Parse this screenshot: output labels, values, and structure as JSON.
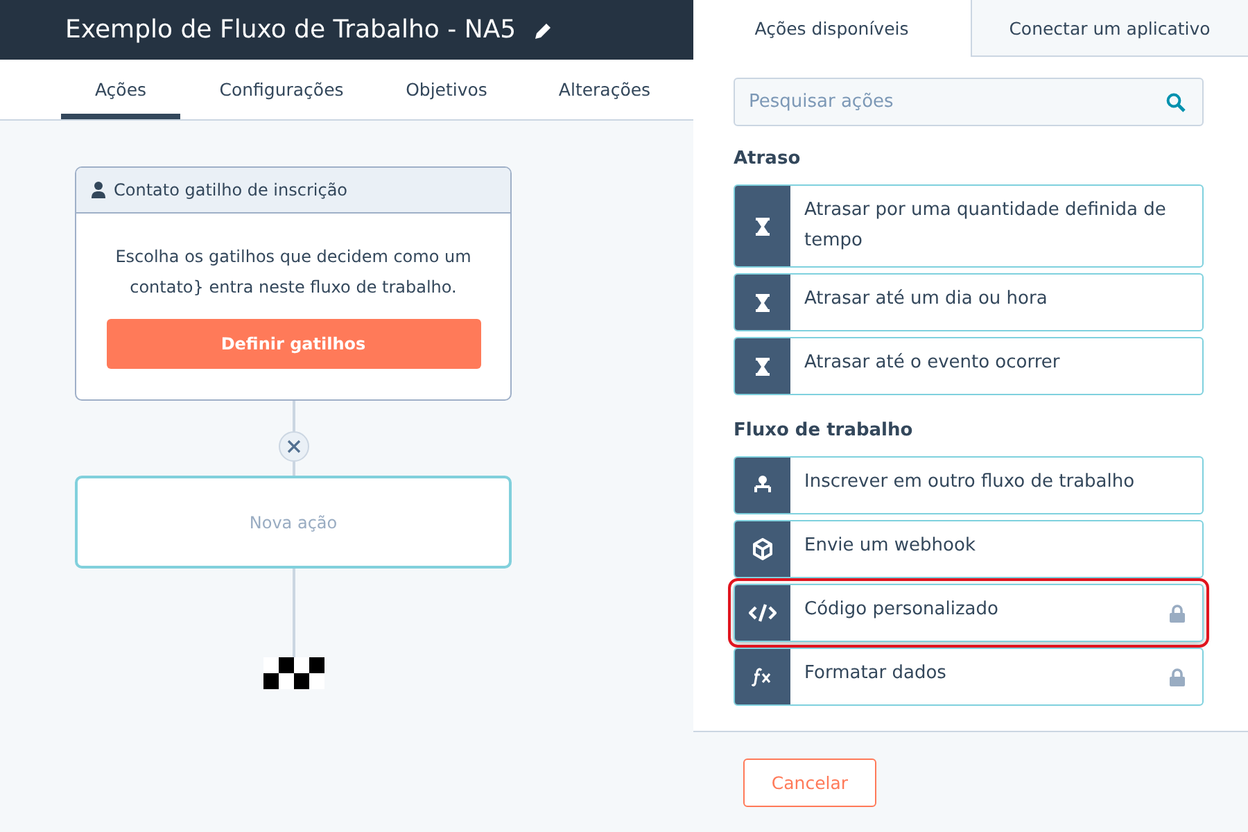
{
  "header": {
    "title": "Exemplo de Fluxo de Trabalho - NA5"
  },
  "tabs": [
    {
      "label": "Ações",
      "selected": true
    },
    {
      "label": "Configurações",
      "selected": false
    },
    {
      "label": "Objetivos",
      "selected": false
    },
    {
      "label": "Alterações",
      "selected": false
    }
  ],
  "canvas": {
    "trigger_card": {
      "title": "Contato gatilho de inscrição",
      "description": "Escolha os gatilhos que decidem como um contato} entra neste fluxo de trabalho.",
      "button": "Definir gatilhos"
    },
    "new_action": {
      "label": "Nova ação"
    }
  },
  "panel": {
    "tabs": [
      {
        "label": "Ações disponíveis",
        "selected": true
      },
      {
        "label": "Conectar um aplicativo",
        "selected": false
      }
    ],
    "search": {
      "placeholder": "Pesquisar ações"
    },
    "sections": [
      {
        "title": "Atraso",
        "items": [
          {
            "label": "Atrasar por uma quantidade definida de tempo",
            "kind": "delay",
            "locked": false,
            "highlighted": false
          },
          {
            "label": "Atrasar até um dia ou hora",
            "kind": "delay",
            "locked": false,
            "highlighted": false
          },
          {
            "label": "Atrasar até o evento ocorrer",
            "kind": "delay",
            "locked": false,
            "highlighted": false
          }
        ]
      },
      {
        "title": "Fluxo de trabalho",
        "items": [
          {
            "label": "Inscrever em outro fluxo de trabalho",
            "kind": "enroll",
            "locked": false,
            "highlighted": false
          },
          {
            "label": "Envie um webhook",
            "kind": "webhook",
            "locked": false,
            "highlighted": false
          },
          {
            "label": "Código personalizado",
            "kind": "code",
            "locked": true,
            "highlighted": true
          },
          {
            "label": "Formatar dados",
            "kind": "format",
            "locked": true,
            "highlighted": false
          }
        ]
      }
    ],
    "cancel_button": "Cancelar"
  }
}
